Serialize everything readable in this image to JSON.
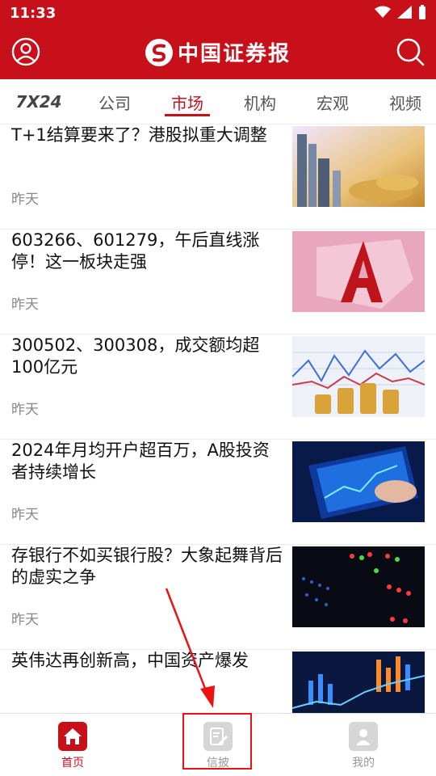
{
  "status": {
    "time": "11:33"
  },
  "header": {
    "brand": "中国证券报"
  },
  "tabs": [
    {
      "label": "7X24"
    },
    {
      "label": "公司"
    },
    {
      "label": "市场",
      "active": true
    },
    {
      "label": "机构"
    },
    {
      "label": "宏观"
    },
    {
      "label": "视频"
    }
  ],
  "feed": [
    {
      "title": "T+1结算要来了？港股拟重大调整",
      "time": "昨天"
    },
    {
      "title": "603266、601279，午后直线涨停！这一板块走强",
      "time": "昨天"
    },
    {
      "title": "300502、300308，成交额均超100亿元",
      "time": "昨天"
    },
    {
      "title": "2024年月均开户超百万，A股投资者持续增长",
      "time": "昨天"
    },
    {
      "title": "存银行不如买银行股？大象起舞背后的虚实之争",
      "time": "昨天"
    },
    {
      "title": "英伟达再创新高，中国资产爆发",
      "time": ""
    }
  ],
  "nav": [
    {
      "label": "首页",
      "icon": "home-icon",
      "active": true
    },
    {
      "label": "信披",
      "icon": "document-edit-icon"
    },
    {
      "label": "我的",
      "icon": "user-icon"
    }
  ],
  "colors": {
    "brand": "#c8101b",
    "highlight": "#e11111"
  }
}
